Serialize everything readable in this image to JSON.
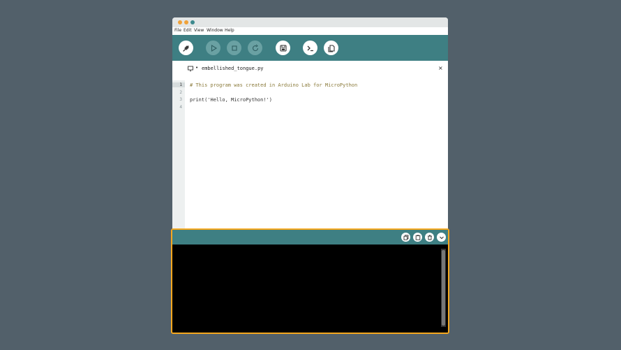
{
  "window": {
    "traffic_lights": [
      "#f0a23a",
      "#f0a23a",
      "#3e8a8e"
    ]
  },
  "menu": [
    "File",
    "Edit",
    "View",
    "Window",
    "Help"
  ],
  "toolbar": {
    "buttons": [
      {
        "name": "connect",
        "icon": "plug-icon"
      },
      {
        "name": "run",
        "icon": "play-icon"
      },
      {
        "name": "stop",
        "icon": "stop-icon"
      },
      {
        "name": "reset",
        "icon": "reset-icon"
      },
      {
        "name": "save",
        "icon": "save-icon"
      },
      {
        "name": "console-toggle",
        "icon": "terminal-icon"
      },
      {
        "name": "files",
        "icon": "files-icon"
      }
    ]
  },
  "editor": {
    "tab": {
      "title": "embellished_tongue.py",
      "modified_marker": "•",
      "close": "×"
    },
    "line_numbers": [
      "1",
      "2",
      "3",
      "4"
    ],
    "lines": [
      "# This program was created in Arduino Lab for MicroPython",
      "",
      "print('Hello, MicroPython!')",
      ""
    ]
  },
  "console": {
    "buttons": [
      "copy-icon",
      "paste-icon",
      "trash-icon",
      "chevron-down-icon"
    ]
  },
  "colors": {
    "accent": "#3e7f83",
    "console_border": "#f5a81e",
    "comment": "#8a7a3a"
  }
}
